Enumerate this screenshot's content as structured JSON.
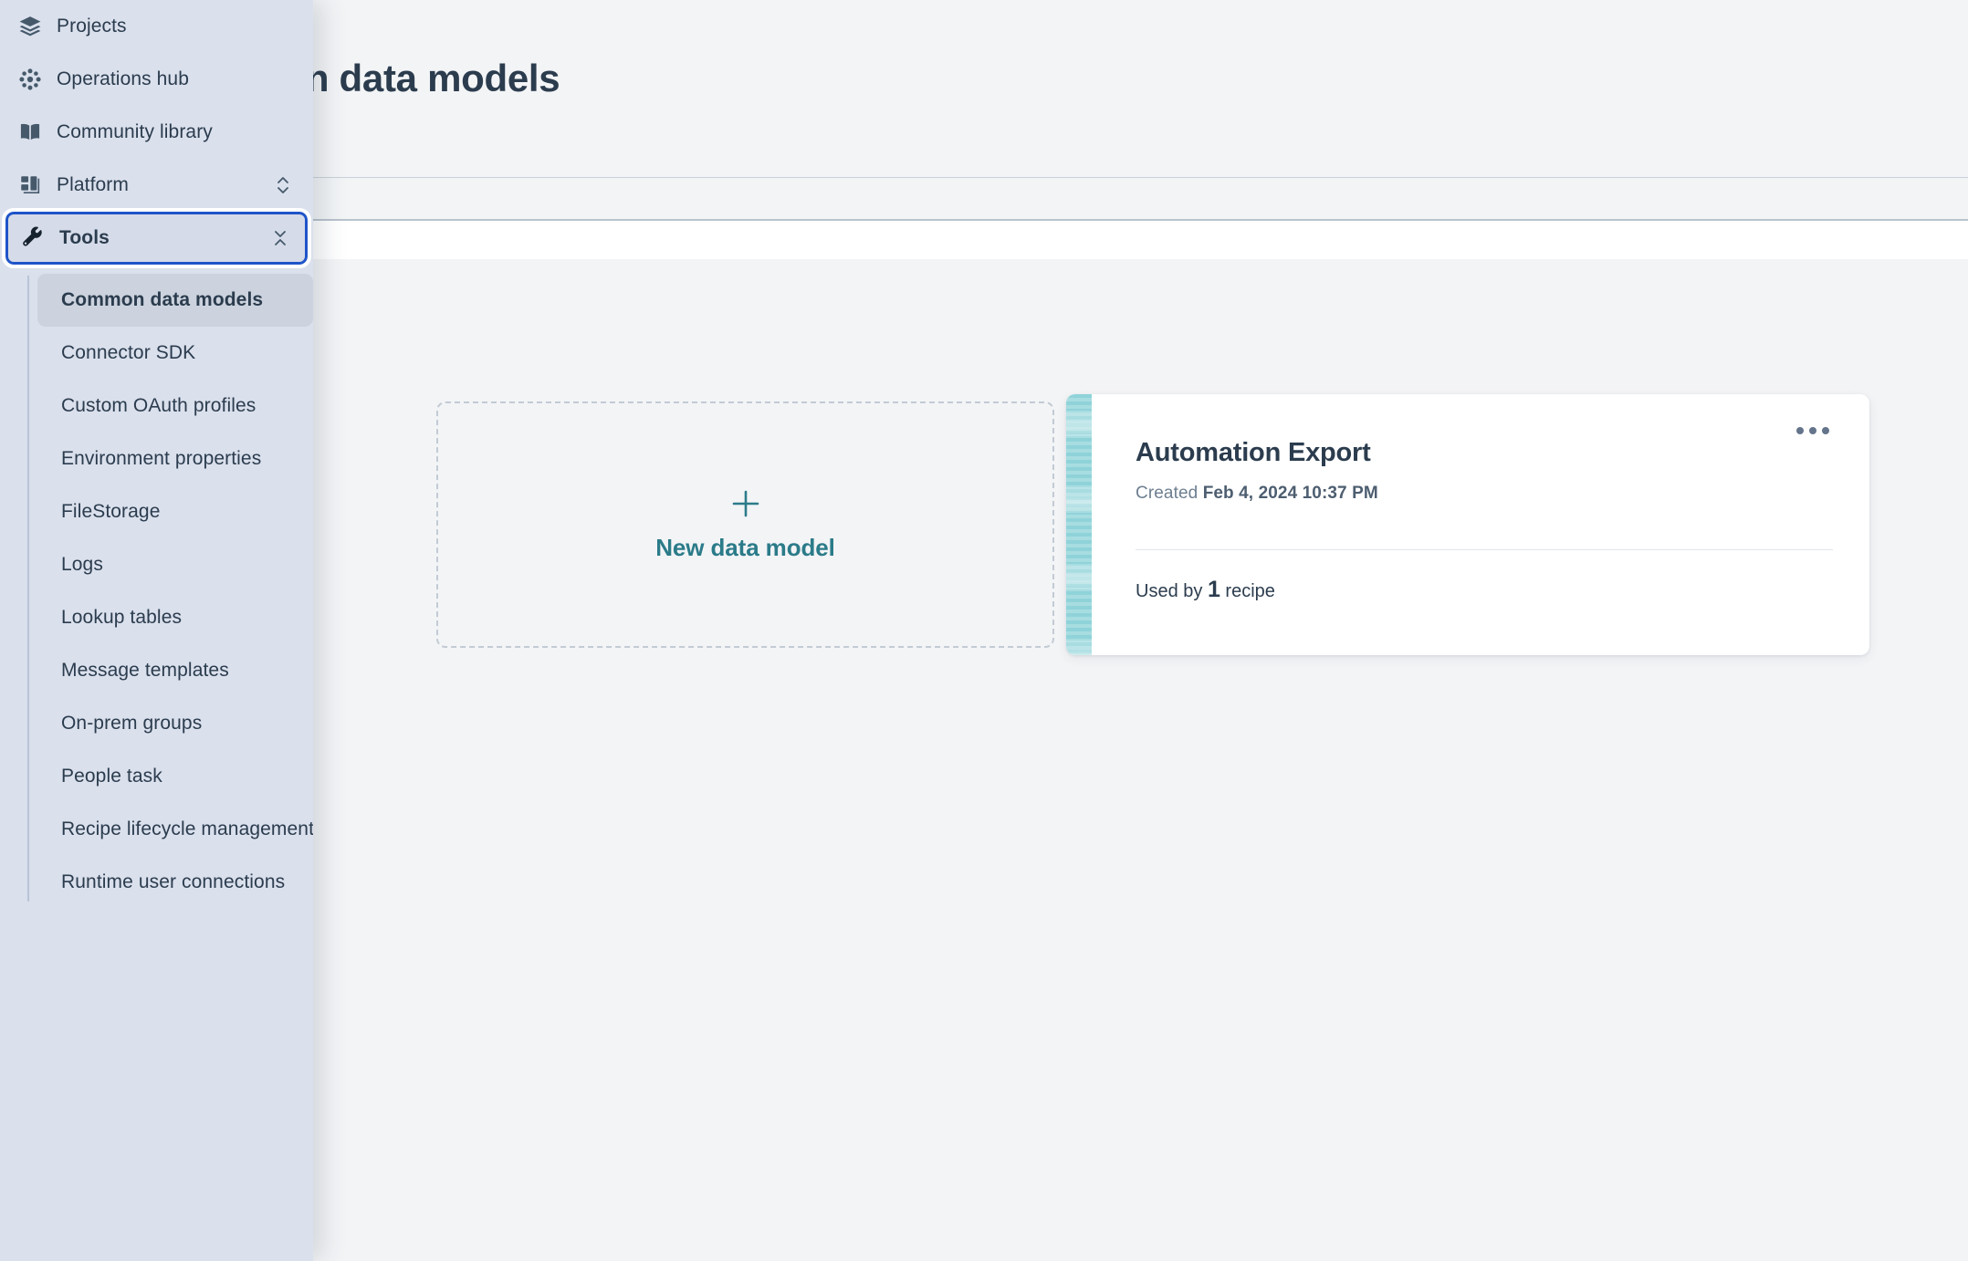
{
  "page": {
    "title": "Common data models",
    "title_visible_fragment": "a models"
  },
  "sidebar": {
    "nav": [
      {
        "label": "Projects",
        "icon": "layers-icon",
        "chevron": "none"
      },
      {
        "label": "Operations hub",
        "icon": "asterisk-icon",
        "chevron": "none"
      },
      {
        "label": "Community library",
        "icon": "book-icon",
        "chevron": "none"
      },
      {
        "label": "Platform",
        "icon": "grid-panels-icon",
        "chevron": "expand-vertical-icon"
      },
      {
        "label": "Tools",
        "icon": "wrench-icon",
        "chevron": "collapse-vertical-icon"
      }
    ],
    "subnav": [
      {
        "label": "Common data models",
        "active": true
      },
      {
        "label": "Connector SDK",
        "active": false
      },
      {
        "label": "Custom OAuth profiles",
        "active": false
      },
      {
        "label": "Environment properties",
        "active": false
      },
      {
        "label": "FileStorage",
        "active": false
      },
      {
        "label": "Logs",
        "active": false
      },
      {
        "label": "Lookup tables",
        "active": false
      },
      {
        "label": "Message templates",
        "active": false
      },
      {
        "label": "On-prem groups",
        "active": false
      },
      {
        "label": "People task",
        "active": false
      },
      {
        "label": "Recipe lifecycle management",
        "active": false
      },
      {
        "label": "Runtime user connections",
        "active": false
      }
    ],
    "focus_ring_color": "#1f54c9",
    "background_color": "#dae0ec"
  },
  "main": {
    "new_card": {
      "label": "New data model",
      "icon": "plus-icon",
      "accent_color": "#2b7b89"
    },
    "model_card": {
      "title": "Automation Export",
      "created_label": "Created",
      "created_value": "Feb 4, 2024 10:37 PM",
      "usage_prefix": "Used by",
      "usage_count": "1",
      "usage_suffix": "recipe",
      "menu_icon": "kebab-menu-icon",
      "accent_color": "#8fd3d9"
    }
  }
}
